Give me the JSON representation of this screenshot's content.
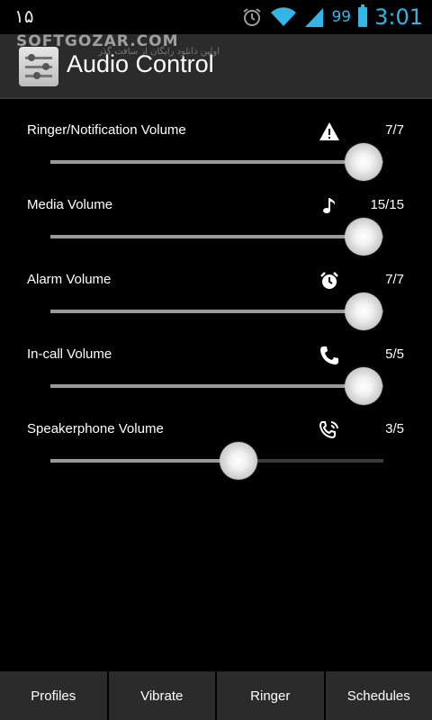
{
  "status_bar": {
    "left_text": "۱۵",
    "battery_level": "99",
    "time": "3:01",
    "icons": [
      "alarm-icon",
      "wifi-icon",
      "signal-icon",
      "battery-icon"
    ]
  },
  "watermark": {
    "text": "SOFTGOZAR.COM",
    "subtext": "اولین دانلود رایگان از سافت گذر"
  },
  "action_bar": {
    "title": "Audio Control",
    "icon": "app-sliders-icon"
  },
  "volumes": [
    {
      "label": "Ringer/Notification Volume",
      "icon": "warning-icon",
      "value_text": "7/7",
      "level": 1.0
    },
    {
      "label": "Media Volume",
      "icon": "music-note-icon",
      "value_text": "15/15",
      "level": 1.0
    },
    {
      "label": "Alarm Volume",
      "icon": "alarm-clock-icon",
      "value_text": "7/7",
      "level": 1.0
    },
    {
      "label": "In-call Volume",
      "icon": "phone-icon",
      "value_text": "5/5",
      "level": 1.0
    },
    {
      "label": "Speakerphone Volume",
      "icon": "speakerphone-icon",
      "value_text": "3/5",
      "level": 0.6
    }
  ],
  "bottom_nav": {
    "profiles": "Profiles",
    "vibrate": "Vibrate",
    "ringer": "Ringer",
    "schedules": "Schedules"
  },
  "colors": {
    "accent": "#33b5e5",
    "action_bar": "#2b2b2b",
    "background": "#000000"
  }
}
